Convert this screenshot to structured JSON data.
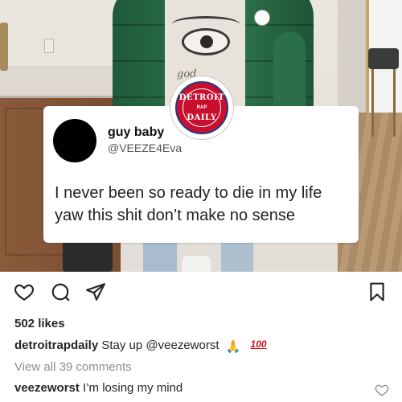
{
  "tweet": {
    "name": "guy baby",
    "handle": "@VEEZE4Eva",
    "text_lines": [
      "I never been so ready to die in my life",
      "yaw this shit don’t make no sense"
    ]
  },
  "badge": {
    "top": "DETROIT",
    "middle": "RAP",
    "bottom": "DAILY",
    "colors": {
      "fill": "#c8102e",
      "ring": "#1f3a8a"
    }
  },
  "photo": {
    "sweater_text": "god"
  },
  "actions": {
    "icons": [
      "heart-icon",
      "comment-icon",
      "share-icon",
      "bookmark-icon"
    ]
  },
  "post": {
    "likes": "502 likes",
    "caption": {
      "username": "detroitrapdaily",
      "text": "Stay up",
      "mention": "@veezeworst",
      "emoji_pray": "🙏",
      "emoji_hundred": "100"
    },
    "view_all": "View all 39 comments",
    "top_comment": {
      "username": "veezeworst",
      "text": "I’m losing my mind"
    }
  }
}
